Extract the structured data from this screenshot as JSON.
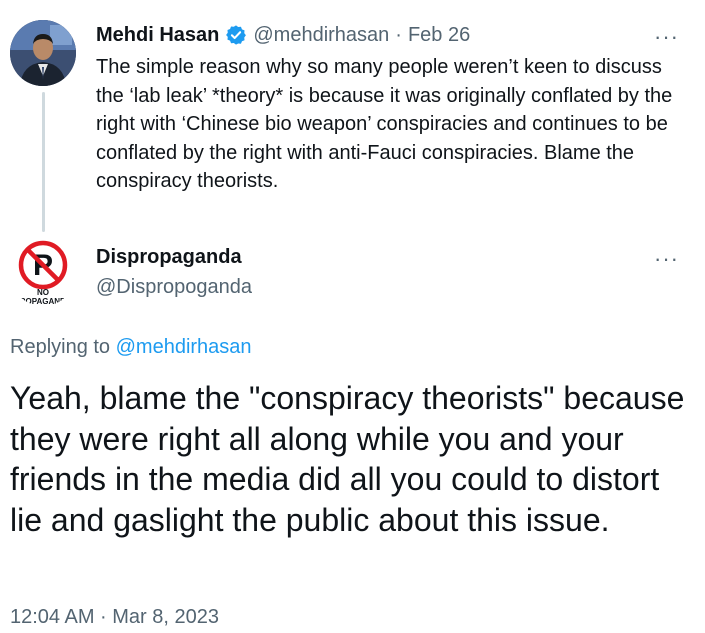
{
  "original_tweet": {
    "author_name": "Mehdi Hasan",
    "handle": "@mehdirhasan",
    "separator": "·",
    "date": "Feb 26",
    "verified_color": "#1d9bf0",
    "text": "The simple reason why so many people weren’t keen to discuss the ‘lab leak’ *theory* is because it was originally conflated by the right with ‘Chinese bio weapon’ conspiracies and continues to be conflated by the right with anti-Fauci conspiracies. Blame the conspiracy theorists.",
    "more_label": "···"
  },
  "reply_tweet": {
    "author_name": "Dispropaganda",
    "handle": "@Dispropoganda",
    "more_label": "···",
    "replying_prefix": "Replying to ",
    "replying_to": "@mehdirhasan",
    "text": "Yeah, blame the \"conspiracy theorists\" because they were right all along while you and your friends in the media did all you could to distort lie and gaslight the public about this issue.",
    "timestamp": "12:04 AM · Mar 8, 2023",
    "avatar_logo_text_top": "NO",
    "avatar_logo_text_bottom": "PROPAGANDA",
    "avatar_logo_letter": "P"
  },
  "colors": {
    "text_primary": "#0f1419",
    "text_secondary": "#536471",
    "link": "#1d9bf0",
    "thread_line": "#cfd9de",
    "no_sign_red": "#e01b24"
  }
}
